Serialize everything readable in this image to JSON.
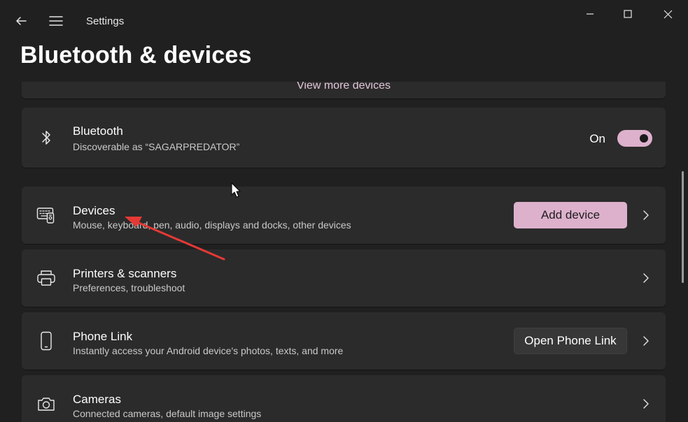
{
  "app": {
    "title": "Settings"
  },
  "titlebar": {
    "back_icon": "back-arrow-icon",
    "menu_icon": "hamburger-menu-icon"
  },
  "window_controls": {
    "minimize_icon": "minimize-icon",
    "maximize_icon": "maximize-icon",
    "close_icon": "close-icon"
  },
  "page": {
    "title": "Bluetooth & devices"
  },
  "top_card": {
    "link": "View more devices"
  },
  "bluetooth": {
    "icon": "bluetooth-icon",
    "title": "Bluetooth",
    "subtitle": "Discoverable as “SAGARPREDATOR”",
    "toggle_label": "On",
    "toggle_on": true,
    "accent_color": "#ddb1cc"
  },
  "rows": [
    {
      "id": "devices",
      "icon": "devices-icon",
      "title": "Devices",
      "subtitle": "Mouse, keyboard, pen, audio, displays and docks, other devices",
      "button": "Add device"
    },
    {
      "id": "printers",
      "icon": "printer-icon",
      "title": "Printers & scanners",
      "subtitle": "Preferences, troubleshoot"
    },
    {
      "id": "phone-link",
      "icon": "phone-icon",
      "title": "Phone Link",
      "subtitle": "Instantly access your Android device's photos, texts, and more",
      "button": "Open Phone Link"
    },
    {
      "id": "cameras",
      "icon": "camera-icon",
      "title": "Cameras",
      "subtitle": "Connected cameras, default image settings"
    }
  ],
  "annotation": {
    "arrow_color": "#e53935",
    "cursor_icon": "mouse-cursor-icon"
  }
}
